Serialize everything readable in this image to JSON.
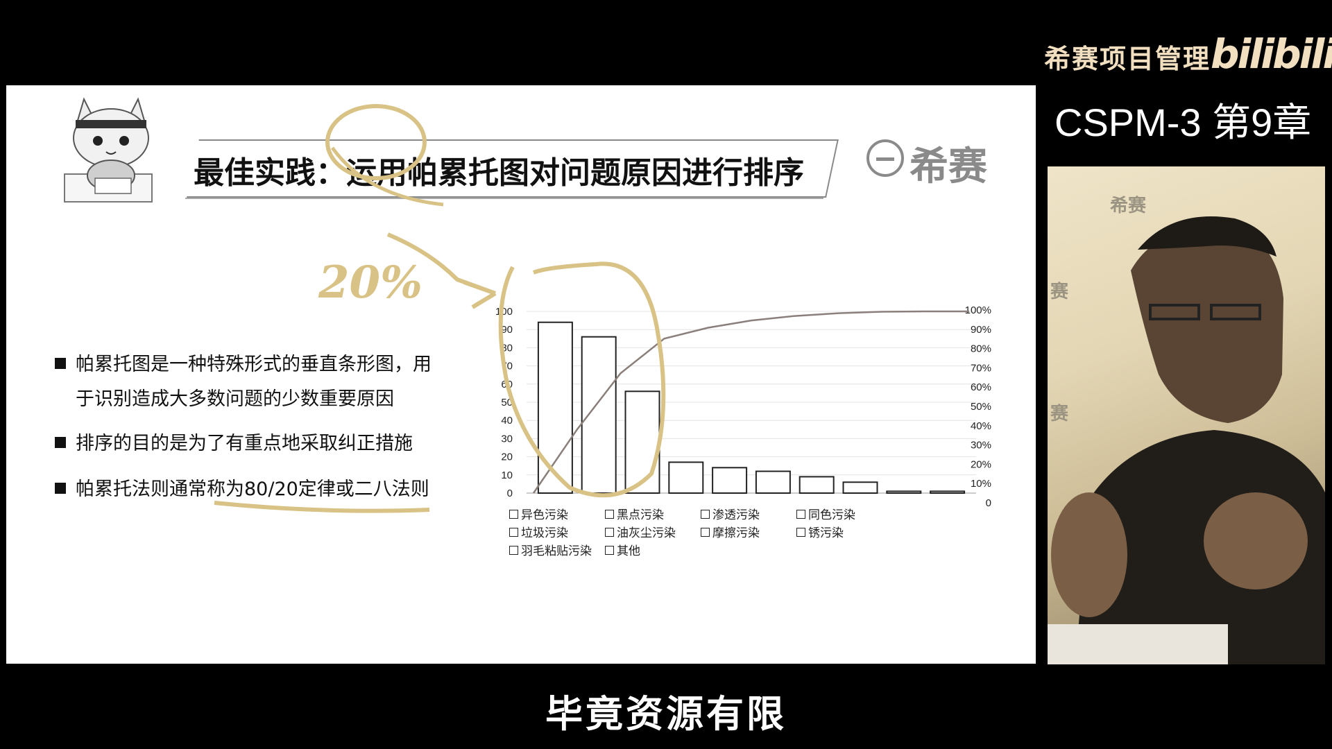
{
  "brand": {
    "name": "希赛项目管理",
    "logo": "bilibili"
  },
  "chapter": "CSPM-3 第9章",
  "slide": {
    "title": "最佳实践：运用帕累托图对问题原因进行排序",
    "logo_text": "希赛",
    "bullets": [
      {
        "line1": "帕累托图是一种特殊形式的垂直条形图，用",
        "line2": "于识别造成大多数问题的少数重要原因"
      },
      {
        "line1": "排序的目的是为了有重点地采取纠正措施",
        "line2": ""
      },
      {
        "line1": "帕累托法则通常称为80/20定律或二八法则",
        "line2": ""
      }
    ],
    "annotation_text": "20%"
  },
  "chart_data": {
    "type": "bar",
    "categories": [
      "异色污染",
      "黑点污染",
      "渗透污染",
      "同色污染",
      "垃圾污染",
      "油灰尘污染",
      "摩擦污染",
      "锈污染",
      "羽毛粘贴污染",
      "其他"
    ],
    "values": [
      94,
      86,
      56,
      17,
      14,
      12,
      9,
      6,
      1,
      1
    ],
    "cumulative_percent": [
      0,
      35,
      66,
      85,
      91,
      95,
      97.5,
      99,
      99.8,
      100,
      100
    ],
    "ylim": [
      0,
      100
    ],
    "y_ticks": [
      "0",
      "10",
      "20",
      "30",
      "40",
      "50",
      "60",
      "70",
      "80",
      "90",
      "100"
    ],
    "y2_ticks": [
      "0",
      "10%",
      "20%",
      "30%",
      "40%",
      "50%",
      "60%",
      "70%",
      "80%",
      "90%",
      "100%"
    ],
    "grid": true,
    "legend_position": "bottom"
  },
  "webcam": {
    "watermark": "希赛",
    "side_char": "赛"
  },
  "subtitle": "毕竟资源有限",
  "colors": {
    "annotation": "#d9c285",
    "brand": "#f1dfc0",
    "slide_bg": "#ffffff",
    "line": "#8a7f7a"
  }
}
